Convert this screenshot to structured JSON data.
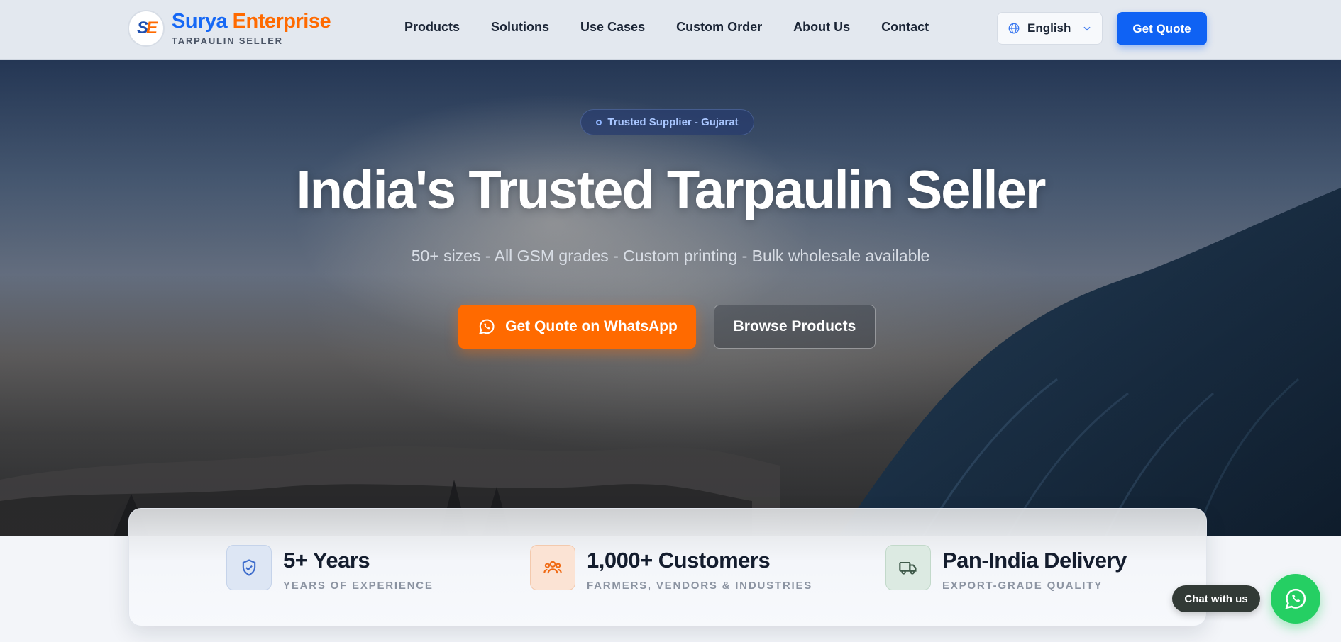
{
  "header": {
    "brand_part1": "Surya",
    "brand_part2": "Enterprise",
    "tagline": "TARPAULIN SELLER",
    "logo_letters": [
      "S",
      "E"
    ],
    "nav": [
      "Products",
      "Solutions",
      "Use Cases",
      "Custom Order",
      "About Us",
      "Contact"
    ],
    "language": "English",
    "quote_label": "Get Quote"
  },
  "hero": {
    "badge": "Trusted Supplier - Gujarat",
    "title": "India's Trusted Tarpaulin Seller",
    "subtitle": "50+ sizes - All GSM grades - Custom printing - Bulk wholesale available",
    "whatsapp_button": "Get Quote on WhatsApp",
    "browse_button": "Browse Products"
  },
  "stats": [
    {
      "icon": "shield-check-icon",
      "value": "5+ Years",
      "label": "YEARS OF EXPERIENCE"
    },
    {
      "icon": "users-icon",
      "value": "1,000+ Customers",
      "label": "FARMERS, VENDORS & INDUSTRIES"
    },
    {
      "icon": "truck-icon",
      "value": "Pan-India Delivery",
      "label": "EXPORT-GRADE QUALITY"
    }
  ],
  "chat": {
    "label": "Chat with us"
  },
  "colors": {
    "brand_blue": "#1668f5",
    "brand_orange": "#ff6a00",
    "primary_button": "#0f62f4",
    "whatsapp_green": "#25cf63"
  }
}
